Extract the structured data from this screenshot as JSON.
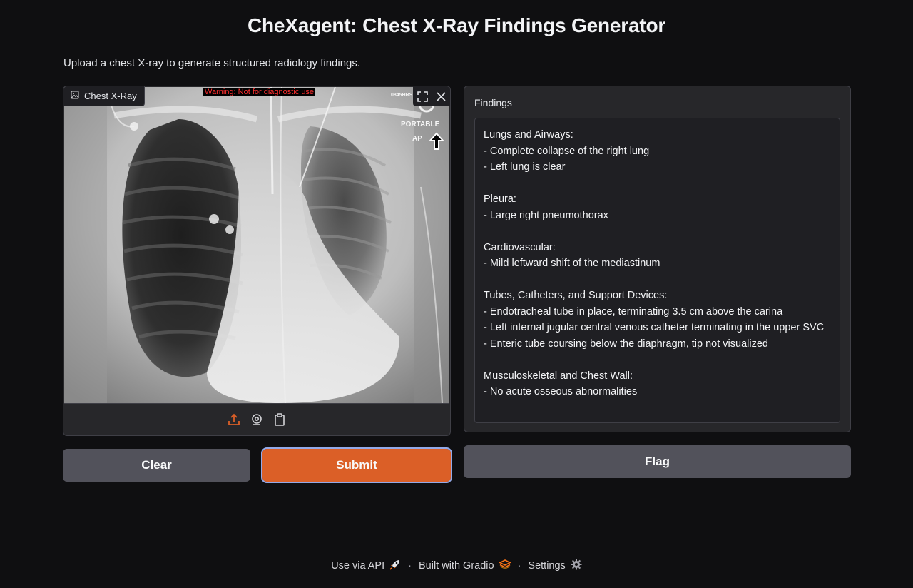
{
  "header": {
    "title": "CheXagent: Chest X-Ray Findings Generator",
    "description": "Upload a chest X-ray to generate structured radiology findings."
  },
  "image_input": {
    "label": "Chest X-Ray",
    "label_icon": "image-icon",
    "overlay_warning": "Warning: Not for diagnostic use",
    "overlay_time": "0845HRS",
    "overlay_portable": "PORTABLE",
    "overlay_ap": "AP",
    "tools": [
      "fullscreen-icon",
      "close-icon"
    ],
    "sources": [
      "upload-icon",
      "webcam-icon",
      "clipboard-icon"
    ]
  },
  "findings": {
    "label": "Findings",
    "text": "Lungs and Airways:\n- Complete collapse of the right lung\n- Left lung is clear\n\nPleura:\n- Large right pneumothorax\n\nCardiovascular:\n- Mild leftward shift of the mediastinum\n\nTubes, Catheters, and Support Devices:\n- Endotracheal tube in place, terminating 3.5 cm above the carina\n- Left internal jugular central venous catheter terminating in the upper SVC\n- Enteric tube coursing below the diaphragm, tip not visualized\n\nMusculoskeletal and Chest Wall:\n- No acute osseous abnormalities"
  },
  "buttons": {
    "clear": "Clear",
    "submit": "Submit",
    "flag": "Flag"
  },
  "footer": {
    "api": "Use via API",
    "built": "Built with Gradio",
    "settings": "Settings",
    "separator": "·"
  },
  "colors": {
    "accent": "#db5f27",
    "background": "#0f0f11",
    "panel": "#27272a",
    "secondary_button": "#52525b"
  }
}
